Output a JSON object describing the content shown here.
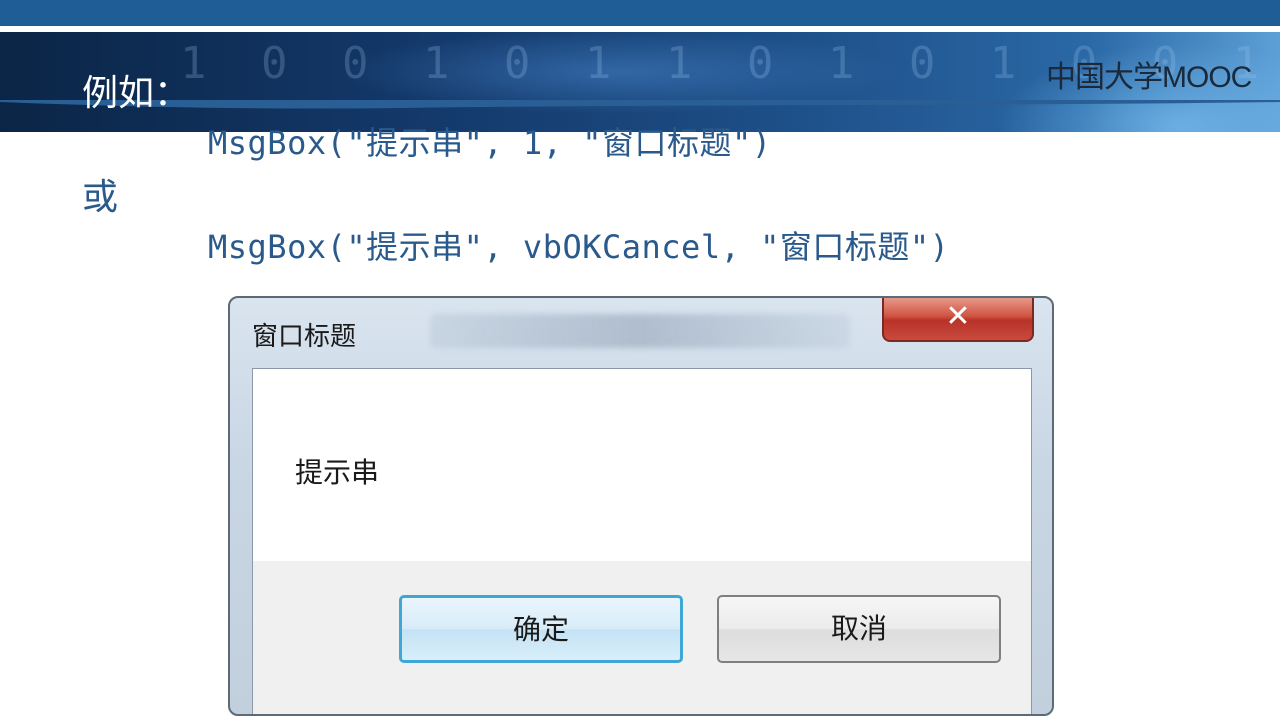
{
  "slide": {
    "heading": "例如：",
    "code_line_1": "MsgBox(\"提示串\", 1, \"窗口标题\")",
    "or_word": "或",
    "code_line_2": "MsgBox(\"提示串\", vbOKCancel, \"窗口标题\")",
    "logo_text": "中国大学MOOC"
  },
  "dialog": {
    "title": "窗口标题",
    "close_icon": "close-x-icon",
    "close_glyph": "✕",
    "message": "提示串",
    "ok_label": "确定",
    "cancel_label": "取消"
  },
  "colors": {
    "top_strip": "#1f5d96",
    "code_text": "#2a5a8c",
    "heading_text": "#ffffff",
    "ok_border": "#3fa7d6",
    "close_red": "#c94a3c"
  }
}
